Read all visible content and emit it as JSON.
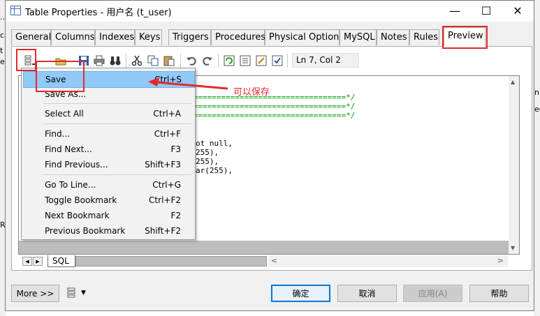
{
  "window": {
    "title": "Table Properties - 用户名 (t_user)",
    "minimize_glyph": "—",
    "maximize_glyph": "☐",
    "close_glyph": "✕"
  },
  "background": {
    "left_glyphs": [
      "...",
      "ca",
      "t",
      "e",
      "Re"
    ],
    "right_glyphs": [
      "nb",
      "ec"
    ]
  },
  "tabs": [
    {
      "label": "General"
    },
    {
      "label": "Columns"
    },
    {
      "label": "Indexes"
    },
    {
      "label": "Keys"
    },
    {
      "label": "Triggers"
    },
    {
      "label": "Procedures"
    },
    {
      "label": "Physical Options"
    },
    {
      "label": "MySQL"
    },
    {
      "label": "Notes"
    },
    {
      "label": "Rules"
    },
    {
      "label": "Preview",
      "active": true
    }
  ],
  "toolbar": {
    "status": "Ln 7, Col 2"
  },
  "editor": {
    "lines": [
      {
        "text": "==================================*/",
        "color": "green"
      },
      {
        "text": "==================================*/",
        "color": "green"
      },
      {
        "text": "==================================*/",
        "color": "green"
      },
      {
        "text": "ot null,",
        "color": "black"
      },
      {
        "text": "255),",
        "color": "black"
      },
      {
        "text": "255),",
        "color": "black"
      },
      {
        "text": "ar(255),",
        "color": "black"
      }
    ]
  },
  "bottom_tabs": {
    "sql_label": "SQL"
  },
  "buttons": {
    "more": "More >>",
    "ok": "确定",
    "cancel": "取消",
    "apply": "应用(A)",
    "help": "帮助"
  },
  "menu": {
    "items": [
      {
        "label": "Save",
        "shortcut": "Ctrl+S",
        "highlighted": true
      },
      {
        "label": "Save As...",
        "shortcut": ""
      },
      {
        "label": "Select All",
        "shortcut": "Ctrl+A"
      },
      {
        "label": "Find...",
        "shortcut": "Ctrl+F"
      },
      {
        "label": "Find Next...",
        "shortcut": "F3"
      },
      {
        "label": "Find Previous...",
        "shortcut": "Shift+F3"
      },
      {
        "label": "Go To Line...",
        "shortcut": "Ctrl+G"
      },
      {
        "label": "Toggle Bookmark",
        "shortcut": "Ctrl+F2"
      },
      {
        "label": "Next Bookmark",
        "shortcut": "F2"
      },
      {
        "label": "Previous Bookmark",
        "shortcut": "Shift+F2"
      }
    ]
  },
  "annotation": {
    "text": "可以保存",
    "color": "#e4282b"
  },
  "colors": {
    "highlight": "#91c9f7",
    "code_green": "#00a000",
    "annotation_red": "#e4282b",
    "default_button_border": "#0078d7"
  }
}
